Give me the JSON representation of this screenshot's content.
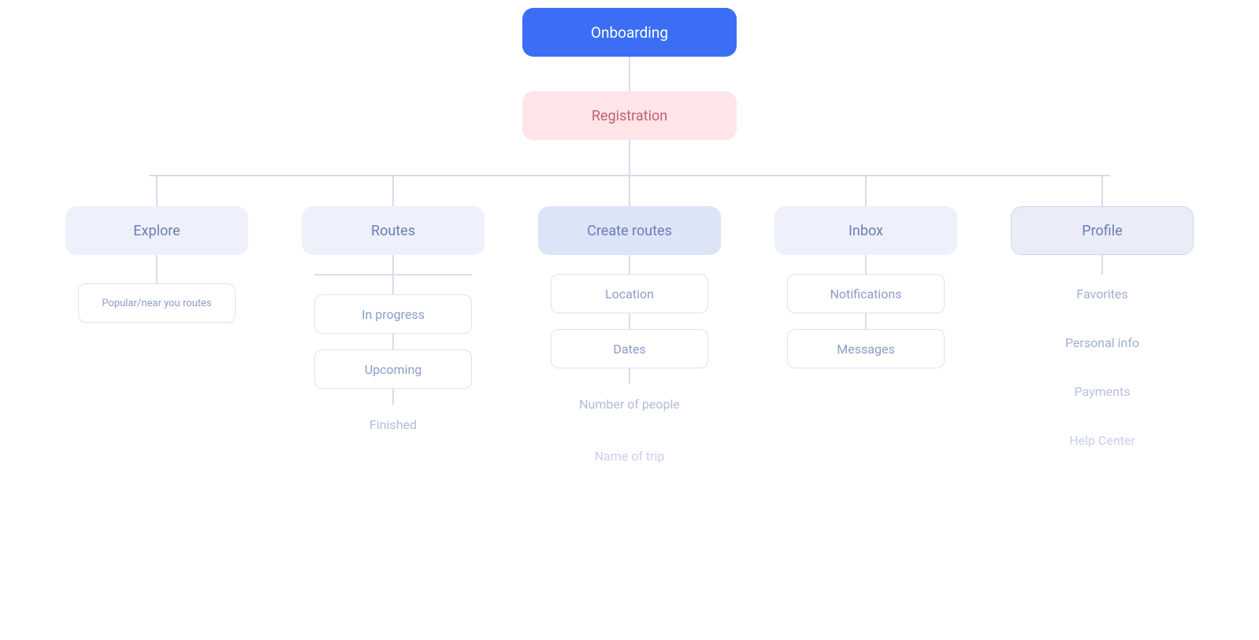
{
  "nodes": {
    "onboarding": "Onboarding",
    "registration": "Registration",
    "explore": "Explore",
    "routes": "Routes",
    "create_routes": "Create routes",
    "inbox": "Inbox",
    "profile": "Profile",
    "popular_near": "Popular/near you routes",
    "in_progress": "In progress",
    "upcoming": "Upcoming",
    "finished": "Finished",
    "location": "Location",
    "dates": "Dates",
    "number_of_people": "Number of people",
    "name_of_trip": "Name of trip",
    "notifications": "Notifications",
    "messages": "Messages",
    "favorites": "Favorites",
    "personal_info": "Personal info",
    "payments": "Payments",
    "help_center": "Help Center"
  },
  "colors": {
    "onboarding_bg": "#3b6ef5",
    "onboarding_text": "#ffffff",
    "registration_bg": "#ffe4e8",
    "registration_text": "#c06070",
    "level2_bg": "#eef1fb",
    "level2_text": "#6b7db3",
    "create_routes_bg": "#dce4f8",
    "leaf_border": "#dde2f0",
    "leaf_text": "#8b9cc8",
    "faint_text": "#b0bcda",
    "connector": "#d8dceb"
  }
}
